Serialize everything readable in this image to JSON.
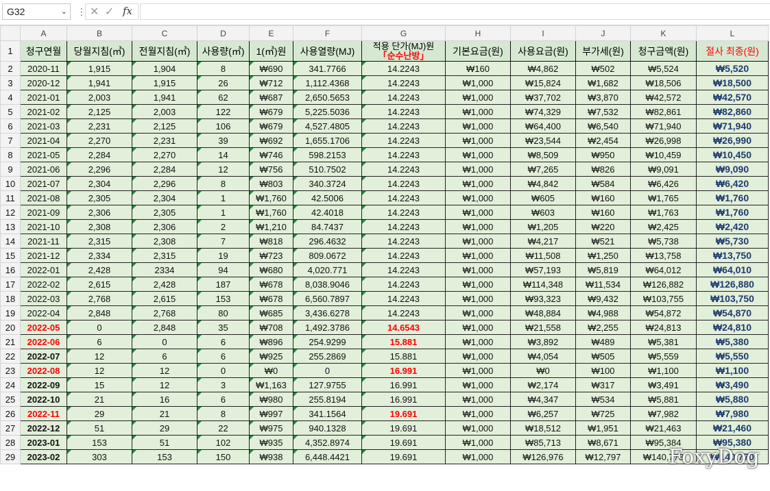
{
  "formula_bar": {
    "name_box": "G32",
    "fx_label": "fx"
  },
  "columns": [
    "A",
    "B",
    "C",
    "D",
    "E",
    "F",
    "G",
    "H",
    "I",
    "J",
    "K",
    "L"
  ],
  "headers": {
    "A": "청구연월",
    "B": "당월지침(㎥)",
    "C": "전월지침(㎥)",
    "D": "사용량(㎥)",
    "E": "1(㎥)원",
    "F": "사용열량(MJ)",
    "G_top": "적용 단가(MJ)원",
    "G_sub": "「순수난방」",
    "H": "기본요금(원)",
    "I": "사용요금(원)",
    "J": "부가세(원)",
    "K": "청구금액(원)",
    "L": "절사 최종(원)"
  },
  "row_numbers": [
    "1",
    "2",
    "3",
    "4",
    "5",
    "6",
    "7",
    "8",
    "9",
    "10",
    "11",
    "12",
    "13",
    "14",
    "15",
    "16",
    "17",
    "18",
    "19",
    "20",
    "21",
    "22",
    "23",
    "24",
    "25",
    "26",
    "27",
    "28",
    "29"
  ],
  "rows": [
    {
      "a": "2020-11",
      "b": "1,915",
      "c": "1,904",
      "d": "8",
      "e": "₩690",
      "f": "341.7766",
      "g": "14.2243",
      "h": "₩160",
      "i": "₩4,862",
      "j": "₩502",
      "k": "₩5,524",
      "l": "₩5,520",
      "a_style": "",
      "g_red": false
    },
    {
      "a": "2020-12",
      "b": "1,941",
      "c": "1,915",
      "d": "26",
      "e": "₩712",
      "f": "1,112.4368",
      "g": "14.2243",
      "h": "₩1,000",
      "i": "₩15,824",
      "j": "₩1,682",
      "k": "₩18,506",
      "l": "₩18,500",
      "a_style": "",
      "g_red": false
    },
    {
      "a": "2021-01",
      "b": "2,003",
      "c": "1,941",
      "d": "62",
      "e": "₩687",
      "f": "2,650.5653",
      "g": "14.2243",
      "h": "₩1,000",
      "i": "₩37,702",
      "j": "₩3,870",
      "k": "₩42,572",
      "l": "₩42,570",
      "a_style": "",
      "g_red": false
    },
    {
      "a": "2021-02",
      "b": "2,125",
      "c": "2,003",
      "d": "122",
      "e": "₩679",
      "f": "5,225.5036",
      "g": "14.2243",
      "h": "₩1,000",
      "i": "₩74,329",
      "j": "₩7,532",
      "k": "₩82,861",
      "l": "₩82,860",
      "a_style": "",
      "g_red": false
    },
    {
      "a": "2021-03",
      "b": "2,231",
      "c": "2,125",
      "d": "106",
      "e": "₩679",
      "f": "4,527.4805",
      "g": "14.2243",
      "h": "₩1,000",
      "i": "₩64,400",
      "j": "₩6,540",
      "k": "₩71,940",
      "l": "₩71,940",
      "a_style": "",
      "g_red": false
    },
    {
      "a": "2021-04",
      "b": "2,270",
      "c": "2,231",
      "d": "39",
      "e": "₩692",
      "f": "1,655.1706",
      "g": "14.2243",
      "h": "₩1,000",
      "i": "₩23,544",
      "j": "₩2,454",
      "k": "₩26,998",
      "l": "₩26,990",
      "a_style": "",
      "g_red": false
    },
    {
      "a": "2021-05",
      "b": "2,284",
      "c": "2,270",
      "d": "14",
      "e": "₩746",
      "f": "598.2153",
      "g": "14.2243",
      "h": "₩1,000",
      "i": "₩8,509",
      "j": "₩950",
      "k": "₩10,459",
      "l": "₩10,450",
      "a_style": "",
      "g_red": false
    },
    {
      "a": "2021-06",
      "b": "2,296",
      "c": "2,284",
      "d": "12",
      "e": "₩756",
      "f": "510.7502",
      "g": "14.2243",
      "h": "₩1,000",
      "i": "₩7,265",
      "j": "₩826",
      "k": "₩9,091",
      "l": "₩9,090",
      "a_style": "",
      "g_red": false
    },
    {
      "a": "2021-07",
      "b": "2,304",
      "c": "2,296",
      "d": "8",
      "e": "₩803",
      "f": "340.3724",
      "g": "14.2243",
      "h": "₩1,000",
      "i": "₩4,842",
      "j": "₩584",
      "k": "₩6,426",
      "l": "₩6,420",
      "a_style": "",
      "g_red": false
    },
    {
      "a": "2021-08",
      "b": "2,305",
      "c": "2,304",
      "d": "1",
      "e": "₩1,760",
      "f": "42.5006",
      "g": "14.2243",
      "h": "₩1,000",
      "i": "₩605",
      "j": "₩160",
      "k": "₩1,765",
      "l": "₩1,760",
      "a_style": "",
      "g_red": false
    },
    {
      "a": "2021-09",
      "b": "2,306",
      "c": "2,305",
      "d": "1",
      "e": "₩1,760",
      "f": "42.4018",
      "g": "14.2243",
      "h": "₩1,000",
      "i": "₩603",
      "j": "₩160",
      "k": "₩1,763",
      "l": "₩1,760",
      "a_style": "",
      "g_red": false
    },
    {
      "a": "2021-10",
      "b": "2,308",
      "c": "2,306",
      "d": "2",
      "e": "₩1,210",
      "f": "84.7437",
      "g": "14.2243",
      "h": "₩1,000",
      "i": "₩1,205",
      "j": "₩220",
      "k": "₩2,425",
      "l": "₩2,420",
      "a_style": "",
      "g_red": false
    },
    {
      "a": "2021-11",
      "b": "2,315",
      "c": "2,308",
      "d": "7",
      "e": "₩818",
      "f": "296.4632",
      "g": "14.2243",
      "h": "₩1,000",
      "i": "₩4,217",
      "j": "₩521",
      "k": "₩5,738",
      "l": "₩5,730",
      "a_style": "",
      "g_red": false
    },
    {
      "a": "2021-12",
      "b": "2,334",
      "c": "2,315",
      "d": "19",
      "e": "₩723",
      "f": "809.0672",
      "g": "14.2243",
      "h": "₩1,000",
      "i": "₩11,508",
      "j": "₩1,250",
      "k": "₩13,758",
      "l": "₩13,750",
      "a_style": "",
      "g_red": false
    },
    {
      "a": "2022-01",
      "b": "2,428",
      "c": "2334",
      "d": "94",
      "e": "₩680",
      "f": "4,020.771",
      "g": "14.2243",
      "h": "₩1,000",
      "i": "₩57,193",
      "j": "₩5,819",
      "k": "₩64,012",
      "l": "₩64,010",
      "a_style": "",
      "g_red": false
    },
    {
      "a": "2022-02",
      "b": "2,615",
      "c": "2,428",
      "d": "187",
      "e": "₩678",
      "f": "8,038.9046",
      "g": "14.2243",
      "h": "₩1,000",
      "i": "₩114,348",
      "j": "₩11,534",
      "k": "₩126,882",
      "l": "₩126,880",
      "a_style": "",
      "g_red": false
    },
    {
      "a": "2022-03",
      "b": "2,768",
      "c": "2,615",
      "d": "153",
      "e": "₩678",
      "f": "6,560.7897",
      "g": "14.2243",
      "h": "₩1,000",
      "i": "₩93,323",
      "j": "₩9,432",
      "k": "₩103,755",
      "l": "₩103,750",
      "a_style": "",
      "g_red": false
    },
    {
      "a": "2022-04",
      "b": "2,848",
      "c": "2,768",
      "d": "80",
      "e": "₩685",
      "f": "3,436.6278",
      "g": "14.2243",
      "h": "₩1,000",
      "i": "₩48,884",
      "j": "₩4,988",
      "k": "₩54,872",
      "l": "₩54,870",
      "a_style": "",
      "g_red": false
    },
    {
      "a": "2022-05",
      "b": "0",
      "c": "2,848",
      "d": "35",
      "e": "₩708",
      "f": "1,492.3786",
      "g": "14.6543",
      "h": "₩1,000",
      "i": "₩21,558",
      "j": "₩2,255",
      "k": "₩24,813",
      "l": "₩24,810",
      "a_style": "red",
      "g_red": true
    },
    {
      "a": "2022-06",
      "b": "6",
      "c": "0",
      "d": "6",
      "e": "₩896",
      "f": "254.9299",
      "g": "15.881",
      "h": "₩1,000",
      "i": "₩3,892",
      "j": "₩489",
      "k": "₩5,381",
      "l": "₩5,380",
      "a_style": "red",
      "g_red": true
    },
    {
      "a": "2022-07",
      "b": "12",
      "c": "6",
      "d": "6",
      "e": "₩925",
      "f": "255.2869",
      "g": "15.881",
      "h": "₩1,000",
      "i": "₩4,054",
      "j": "₩505",
      "k": "₩5,559",
      "l": "₩5,550",
      "a_style": "bold",
      "g_red": false
    },
    {
      "a": "2022-08",
      "b": "12",
      "c": "12",
      "d": "0",
      "e": "₩0",
      "f": "0",
      "g": "16.991",
      "h": "₩1,000",
      "i": "₩0",
      "j": "₩100",
      "k": "₩1,100",
      "l": "₩1,100",
      "a_style": "red",
      "g_red": true
    },
    {
      "a": "2022-09",
      "b": "15",
      "c": "12",
      "d": "3",
      "e": "₩1,163",
      "f": "127.9755",
      "g": "16.991",
      "h": "₩1,000",
      "i": "₩2,174",
      "j": "₩317",
      "k": "₩3,491",
      "l": "₩3,490",
      "a_style": "bold",
      "g_red": false
    },
    {
      "a": "2022-10",
      "b": "21",
      "c": "16",
      "d": "6",
      "e": "₩980",
      "f": "255.8194",
      "g": "16.991",
      "h": "₩1,000",
      "i": "₩4,347",
      "j": "₩534",
      "k": "₩5,881",
      "l": "₩5,880",
      "a_style": "bold",
      "g_red": false
    },
    {
      "a": "2022-11",
      "b": "29",
      "c": "21",
      "d": "8",
      "e": "₩997",
      "f": "341.1564",
      "g": "19.691",
      "h": "₩1,000",
      "i": "₩6,257",
      "j": "₩725",
      "k": "₩7,982",
      "l": "₩7,980",
      "a_style": "red",
      "g_red": true
    },
    {
      "a": "2022-12",
      "b": "51",
      "c": "29",
      "d": "22",
      "e": "₩975",
      "f": "940.1328",
      "g": "19.691",
      "h": "₩1,000",
      "i": "₩18,512",
      "j": "₩1,951",
      "k": "₩21,463",
      "l": "₩21,460",
      "a_style": "bold",
      "g_red": false
    },
    {
      "a": "2023-01",
      "b": "153",
      "c": "51",
      "d": "102",
      "e": "₩935",
      "f": "4,352.8974",
      "g": "19.691",
      "h": "₩1,000",
      "i": "₩85,713",
      "j": "₩8,671",
      "k": "₩95,384",
      "l": "₩95,380",
      "a_style": "bold",
      "g_red": false
    },
    {
      "a": "2023-02",
      "b": "303",
      "c": "153",
      "d": "150",
      "e": "₩938",
      "f": "6,448.4421",
      "g": "19.691",
      "h": "₩1,000",
      "i": "₩126,976",
      "j": "₩12,797",
      "k": "₩140,773",
      "l": "₩140,770",
      "a_style": "bold",
      "g_red": false
    }
  ],
  "watermark": "FoxyDog",
  "colors": {
    "header_fill": "#d6e8d2",
    "data_fill": "#e2efda",
    "final_text": "#1f3a6e",
    "highlight_red": "#ff0000"
  },
  "icons": {
    "name_box_dropdown": "chevron-down-icon",
    "cancel": "x-icon",
    "confirm": "check-icon",
    "insert_function": "fx-icon"
  }
}
